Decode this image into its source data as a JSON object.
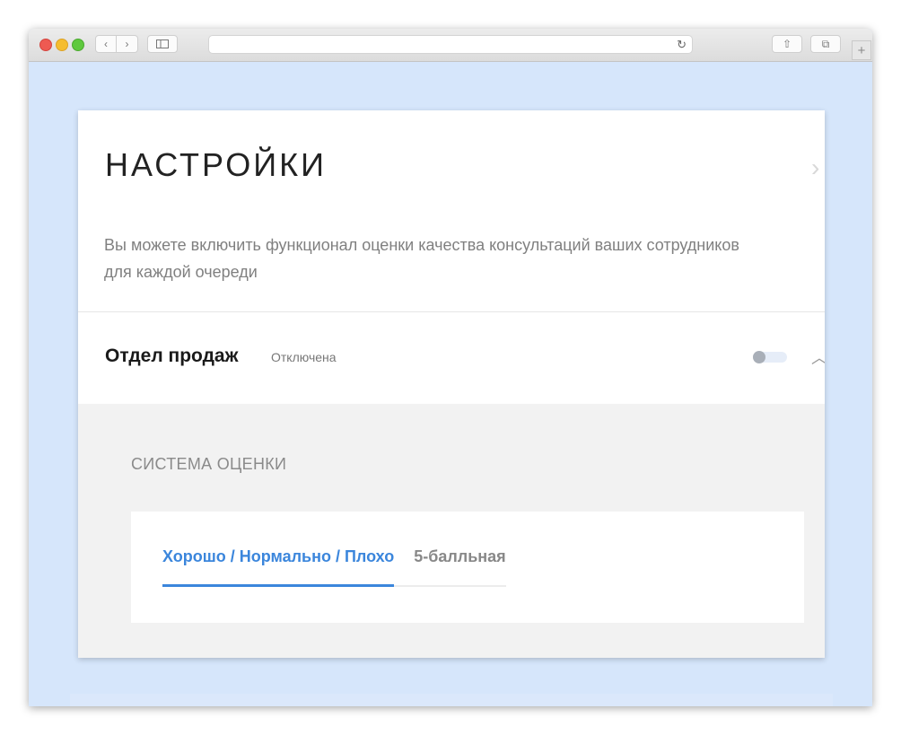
{
  "browser": {
    "url": "",
    "icons": {
      "back": "chevron-left-icon",
      "forward": "chevron-right-icon",
      "sidebar": "sidebar-icon",
      "reload": "reload-icon",
      "share": "share-icon",
      "tabs": "tabs-icon",
      "new_tab": "plus-icon"
    },
    "glyphs": {
      "back": "‹",
      "forward": "›",
      "reload": "↻",
      "share": "⇧",
      "tabs": "⧉",
      "new_tab": "+"
    },
    "colors": {
      "page_background": "#d6e6fb"
    }
  },
  "settings": {
    "title": "НАСТРОЙКИ",
    "description": "Вы можете включить функционал оценки качества консультаций ваших сотрудников для каждой очереди",
    "queue": {
      "name": "Отдел продаж",
      "status": "Отключена",
      "enabled": false
    },
    "rating": {
      "section_title": "СИСТЕМА ОЦЕНКИ",
      "tabs": [
        {
          "label": "Хорошо / Нормально / Плохо",
          "active": true
        },
        {
          "label": "5-балльная",
          "active": false
        }
      ]
    },
    "colors": {
      "accent": "#3b86dc",
      "muted_text": "#808080"
    }
  }
}
